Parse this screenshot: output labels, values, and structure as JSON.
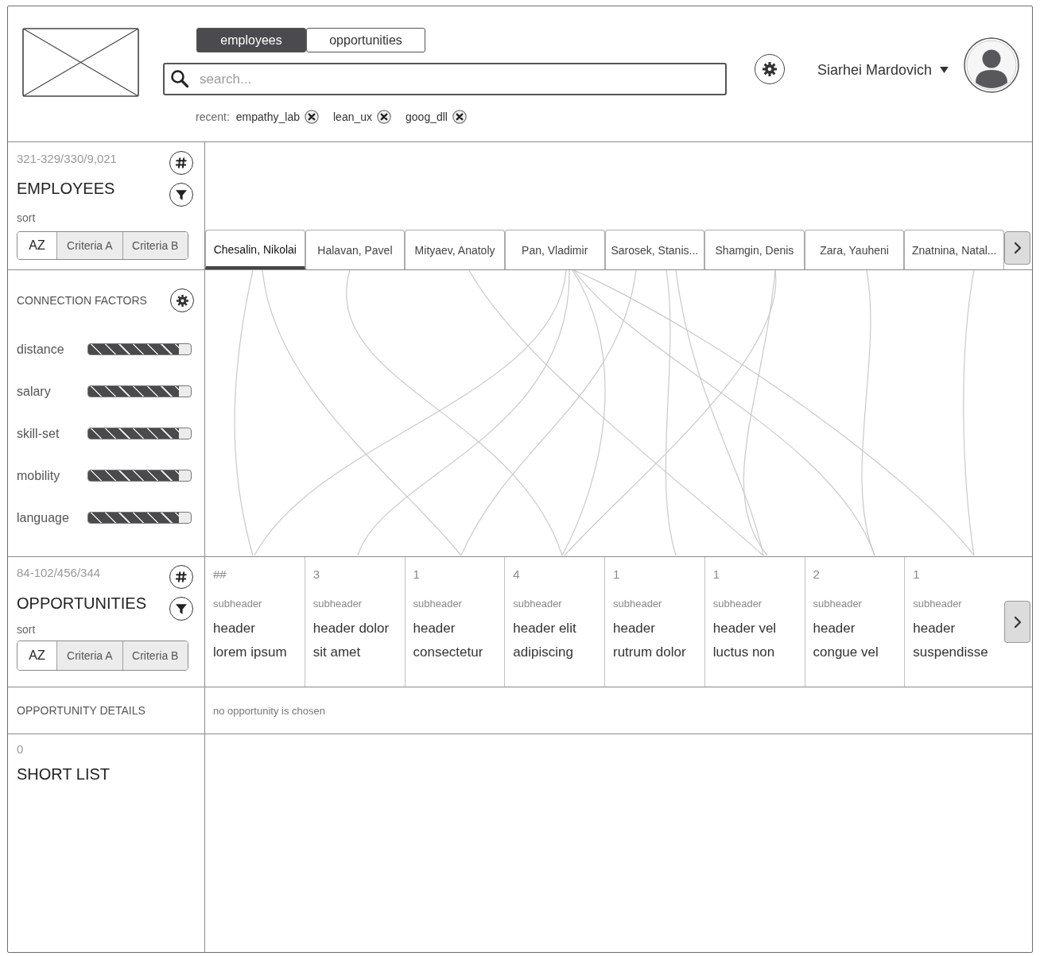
{
  "mode_tabs": [
    {
      "label": "employees",
      "selected": true
    },
    {
      "label": "opportunities",
      "selected": false
    }
  ],
  "search": {
    "placeholder": "search..."
  },
  "recent": {
    "label": "recent:",
    "items": [
      "empathy_lab",
      "lean_ux",
      "goog_dll"
    ]
  },
  "user": {
    "name": "Siarhei Mardovich"
  },
  "employees_panel": {
    "count": "321-329/330/9,021",
    "title": "EMPLOYEES",
    "sort_label": "sort",
    "sort_options": [
      {
        "label": "AZ",
        "selected": true
      },
      {
        "label": "Criteria A",
        "selected": false
      },
      {
        "label": "Criteria B",
        "selected": false
      }
    ]
  },
  "employee_tabs": [
    {
      "label": "Chesalin, Nikolai",
      "selected": true
    },
    {
      "label": "Halavan, Pavel",
      "selected": false
    },
    {
      "label": "Mityaev, Anatoly",
      "selected": false
    },
    {
      "label": "Pan, Vladimir",
      "selected": false
    },
    {
      "label": "Sarosek, Stanis...",
      "selected": false
    },
    {
      "label": "Shamgin, Denis",
      "selected": false
    },
    {
      "label": "Zara, Yauheni",
      "selected": false
    },
    {
      "label": "Znatnina, Natal...",
      "selected": false
    }
  ],
  "connection_factors": {
    "title": "CONNECTION FACTORS",
    "factors": [
      {
        "name": "distance",
        "level": 0.88
      },
      {
        "name": "salary",
        "level": 0.88
      },
      {
        "name": "skill-set",
        "level": 0.88
      },
      {
        "name": "mobility",
        "level": 0.88
      },
      {
        "name": "language",
        "level": 0.88
      }
    ]
  },
  "opportunities_panel": {
    "count": "84-102/456/344",
    "title": "OPPORTUNITIES",
    "sort_label": "sort",
    "sort_options": [
      {
        "label": "AZ",
        "selected": true
      },
      {
        "label": "Criteria A",
        "selected": false
      },
      {
        "label": "Criteria B",
        "selected": false
      }
    ]
  },
  "opportunities": [
    {
      "count": "##",
      "subheader": "subheader",
      "header": "header",
      "text": "lorem ipsum"
    },
    {
      "count": "3",
      "subheader": "subheader",
      "header": "header dolor",
      "text": "sit amet"
    },
    {
      "count": "1",
      "subheader": "subheader",
      "header": "header",
      "text": "consectetur"
    },
    {
      "count": "4",
      "subheader": "subheader",
      "header": "header elit",
      "text": "adipiscing"
    },
    {
      "count": "1",
      "subheader": "subheader",
      "header": "header",
      "text": "rutrum dolor"
    },
    {
      "count": "1",
      "subheader": "subheader",
      "header": "header vel",
      "text": "luctus non"
    },
    {
      "count": "2",
      "subheader": "subheader",
      "header": "header",
      "text": "congue vel"
    },
    {
      "count": "1",
      "subheader": "subheader",
      "header": "header",
      "text": "suspendisse"
    }
  ],
  "opportunity_details": {
    "title": "OPPORTUNITY DETAILS",
    "message": "no opportunity is chosen"
  },
  "short_list": {
    "count": "0",
    "title": "SHORT LIST"
  }
}
